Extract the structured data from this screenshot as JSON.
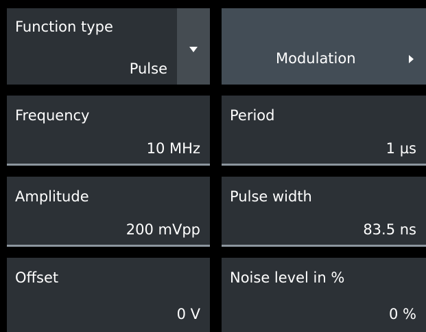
{
  "function_type": {
    "label": "Function type",
    "value": "Pulse",
    "dropdown_icon": "triangle-down-icon"
  },
  "modulation": {
    "label": "Modulation",
    "icon": "triangle-right-icon"
  },
  "fields": {
    "frequency": {
      "label": "Frequency",
      "value": "10 MHz"
    },
    "period": {
      "label": "Period",
      "value": "1 µs"
    },
    "amplitude": {
      "label": "Amplitude",
      "value": "200 mVpp"
    },
    "pulse_width": {
      "label": "Pulse width",
      "value": "83.5 ns"
    },
    "offset": {
      "label": "Offset",
      "value": "0 V"
    },
    "noise_level": {
      "label": "Noise level in %",
      "value": "0 %"
    }
  },
  "colors": {
    "background": "#000000",
    "cell": "#2c3136",
    "underline": "#8c969e",
    "button": "#434d56",
    "dropdown": "#454c52",
    "text": "#ffffff"
  }
}
